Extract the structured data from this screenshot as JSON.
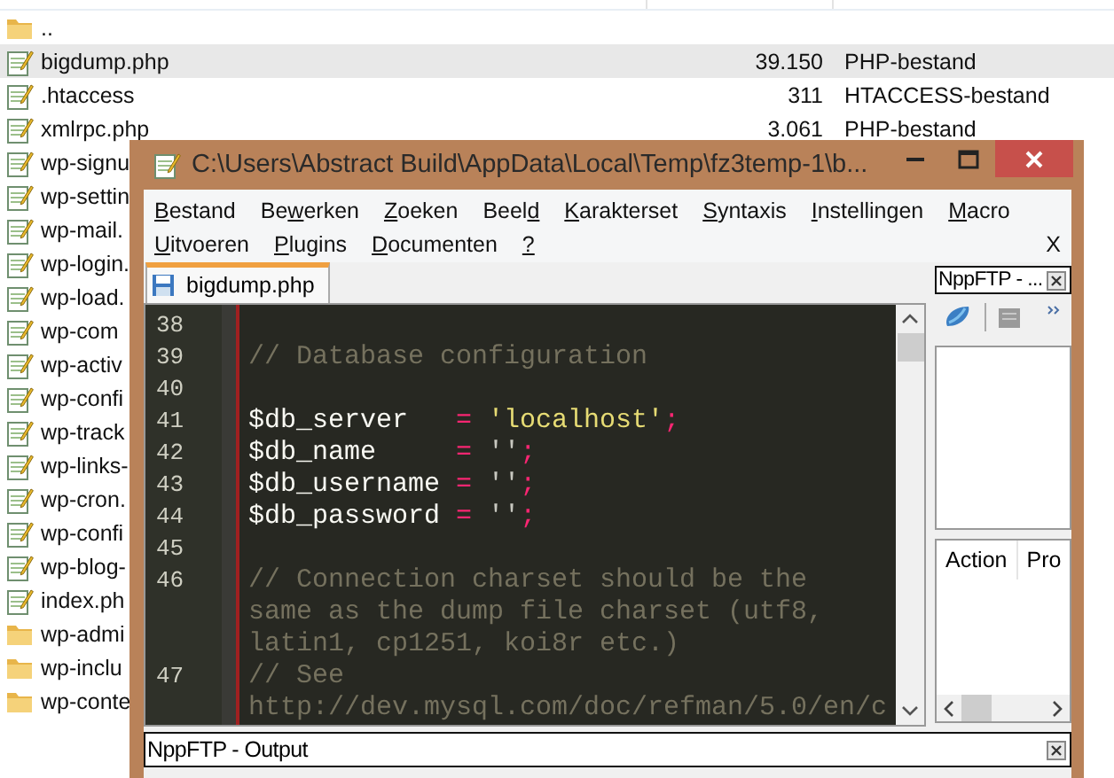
{
  "explorer": {
    "rows": [
      {
        "kind": "folder",
        "name": "..",
        "selected": false
      },
      {
        "kind": "php",
        "name": "bigdump.php",
        "size": "39.150",
        "type": "PHP-bestand",
        "selected": true
      },
      {
        "kind": "php",
        "name": ".htaccess",
        "size": "311",
        "type": "HTACCESS-bestand",
        "selected": false
      },
      {
        "kind": "php",
        "name": "xmlrpc.php",
        "size": "3.061",
        "type": "PHP-bestand",
        "selected": false
      },
      {
        "kind": "php",
        "name": "wp-signu",
        "selected": false
      },
      {
        "kind": "php",
        "name": "wp-settin",
        "selected": false
      },
      {
        "kind": "php",
        "name": "wp-mail.",
        "selected": false
      },
      {
        "kind": "php",
        "name": "wp-login.",
        "selected": false
      },
      {
        "kind": "php",
        "name": "wp-load.",
        "selected": false
      },
      {
        "kind": "php",
        "name": "wp-com",
        "selected": false
      },
      {
        "kind": "php",
        "name": "wp-activ",
        "selected": false
      },
      {
        "kind": "php",
        "name": "wp-confi",
        "selected": false
      },
      {
        "kind": "php",
        "name": "wp-track",
        "selected": false
      },
      {
        "kind": "php",
        "name": "wp-links-",
        "selected": false
      },
      {
        "kind": "php",
        "name": "wp-cron.",
        "selected": false
      },
      {
        "kind": "php",
        "name": "wp-confi",
        "selected": false
      },
      {
        "kind": "php",
        "name": "wp-blog-",
        "selected": false
      },
      {
        "kind": "php",
        "name": "index.ph",
        "selected": false
      },
      {
        "kind": "folder",
        "name": "wp-admi",
        "selected": false
      },
      {
        "kind": "folder",
        "name": "wp-inclu",
        "selected": false
      },
      {
        "kind": "folder",
        "name": "wp-conte",
        "selected": false
      }
    ]
  },
  "window": {
    "title": "C:\\Users\\Abstract Build\\AppData\\Local\\Temp\\fz3temp-1\\b...",
    "menu_rows": [
      {
        "items": [
          {
            "key": "B",
            "after": "estand"
          },
          {
            "before": "Be",
            "key": "w",
            "after": "erken"
          },
          {
            "key": "Z",
            "after": "oeken"
          },
          {
            "before": "Beel",
            "key": "d"
          },
          {
            "key": "K",
            "after": "arakterset"
          },
          {
            "key": "S",
            "after": "yntaxis"
          },
          {
            "key": "I",
            "after": "nstellingen"
          },
          {
            "key": "M",
            "after": "acro"
          }
        ]
      },
      {
        "items": [
          {
            "key": "U",
            "after": "itvoeren"
          },
          {
            "key": "P",
            "after": "lugins"
          },
          {
            "key": "D",
            "after": "ocumenten"
          },
          {
            "key": "?"
          }
        ],
        "close": "X"
      }
    ],
    "tabs": [
      {
        "label": "bigdump.php",
        "selected": true
      }
    ],
    "editor": {
      "lines": [
        {
          "number": "38",
          "rows": [
            []
          ]
        },
        {
          "number": "39",
          "rows": [
            [
              {
                "kind": "comment",
                "text": "// Database configuration"
              }
            ]
          ]
        },
        {
          "number": "40",
          "rows": [
            []
          ]
        },
        {
          "number": "41",
          "rows": [
            [
              {
                "kind": "variable",
                "text": "$db_server   "
              },
              {
                "kind": "operator",
                "text": "= "
              },
              {
                "kind": "string",
                "text": "'localhost'"
              },
              {
                "kind": "operator",
                "text": ";"
              }
            ]
          ]
        },
        {
          "number": "42",
          "rows": [
            [
              {
                "kind": "variable",
                "text": "$db_name     "
              },
              {
                "kind": "operator",
                "text": "= "
              },
              {
                "kind": "quote",
                "text": "''"
              },
              {
                "kind": "operator",
                "text": ";"
              }
            ]
          ]
        },
        {
          "number": "43",
          "rows": [
            [
              {
                "kind": "variable",
                "text": "$db_username "
              },
              {
                "kind": "operator",
                "text": "= "
              },
              {
                "kind": "quote",
                "text": "''"
              },
              {
                "kind": "operator",
                "text": ";"
              }
            ]
          ]
        },
        {
          "number": "44",
          "rows": [
            [
              {
                "kind": "variable",
                "text": "$db_password "
              },
              {
                "kind": "operator",
                "text": "= "
              },
              {
                "kind": "quote",
                "text": "''"
              },
              {
                "kind": "operator",
                "text": ";"
              }
            ]
          ]
        },
        {
          "number": "45",
          "rows": [
            []
          ]
        },
        {
          "number": "46",
          "rows": [
            [
              {
                "kind": "comment",
                "text": "// Connection charset should be the"
              }
            ],
            [
              {
                "kind": "comment",
                "text": "same as the dump file charset (utf8,"
              }
            ],
            [
              {
                "kind": "comment",
                "text": "latin1, cp1251, koi8r etc.)"
              }
            ]
          ]
        },
        {
          "number": "47",
          "rows": [
            [
              {
                "kind": "comment",
                "text": "// See"
              }
            ],
            [
              {
                "kind": "comment",
                "text": "http://dev.mysql.com/doc/refman/5.0/en/c"
              }
            ]
          ]
        }
      ]
    },
    "ftp_panel": {
      "title": "NppFTP - ...",
      "columns": [
        "Action",
        "Pro"
      ]
    },
    "output_panel": {
      "title": "NppFTP - Output"
    }
  }
}
